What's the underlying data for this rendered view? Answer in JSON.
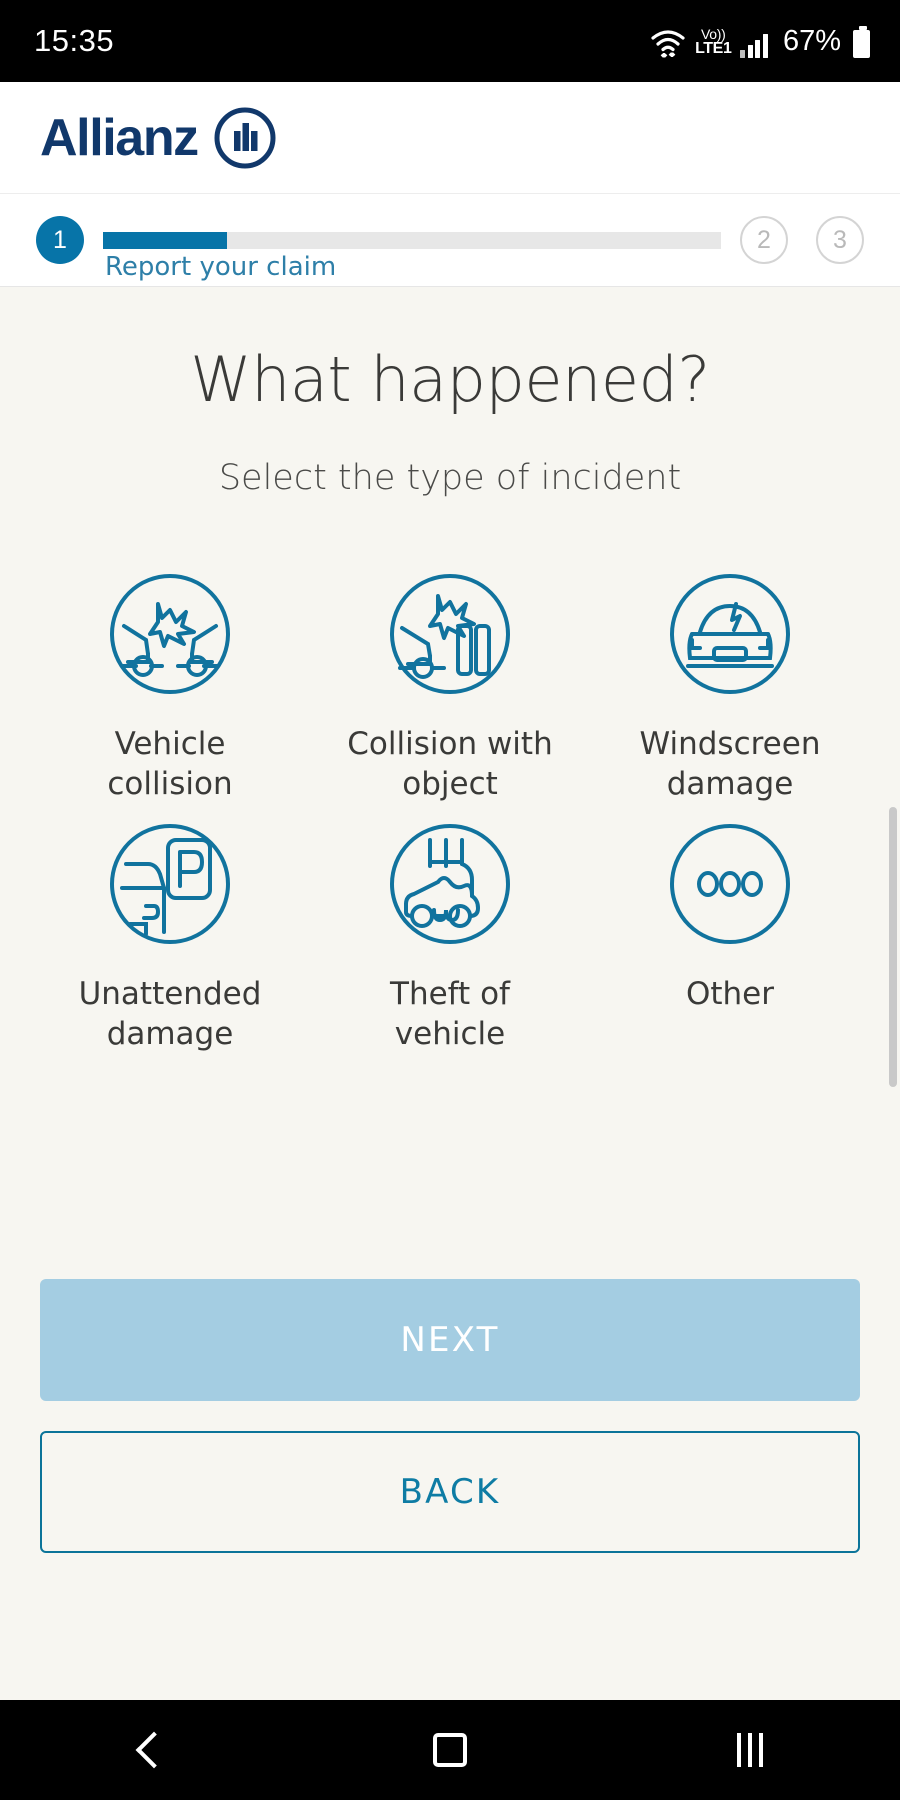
{
  "status_bar": {
    "time": "15:35",
    "volte_top": "Vo))",
    "volte_bottom": "LTE1",
    "battery_percent": "67%",
    "wifi_icon": "wifi-icon",
    "signal_icon": "signal-bars-icon",
    "battery_icon": "battery-icon"
  },
  "brand": {
    "name": "Allianz",
    "logo_color": "#11386B",
    "logo_mark": "allianz-bars-logo"
  },
  "stepper": {
    "steps": [
      {
        "number": "1",
        "state": "active"
      },
      {
        "number": "2",
        "state": "idle"
      },
      {
        "number": "3",
        "state": "idle"
      }
    ],
    "current_label": "Report your claim",
    "progress_percent": 20,
    "accent_color": "#0774A8"
  },
  "main": {
    "title": "What happened?",
    "subtitle": "Select the type of incident",
    "options": [
      {
        "label": "Vehicle collision",
        "icon": "vehicle-collision-icon"
      },
      {
        "label": "Collision with object",
        "icon": "collision-with-object-icon"
      },
      {
        "label": "Windscreen damage",
        "icon": "windscreen-damage-icon"
      },
      {
        "label": "Unattended damage",
        "icon": "unattended-damage-icon"
      },
      {
        "label": "Theft of vehicle",
        "icon": "theft-of-vehicle-icon"
      },
      {
        "label": "Other",
        "icon": "other-ellipsis-icon"
      }
    ],
    "icon_color": "#11739E"
  },
  "actions": {
    "next_label": "NEXT",
    "next_color": "#A4CDE2",
    "back_label": "BACK",
    "back_color": "#0E7CA4"
  },
  "nav_bar": {
    "back": "nav-back-icon",
    "home": "nav-home-icon",
    "recents": "nav-recents-icon"
  }
}
